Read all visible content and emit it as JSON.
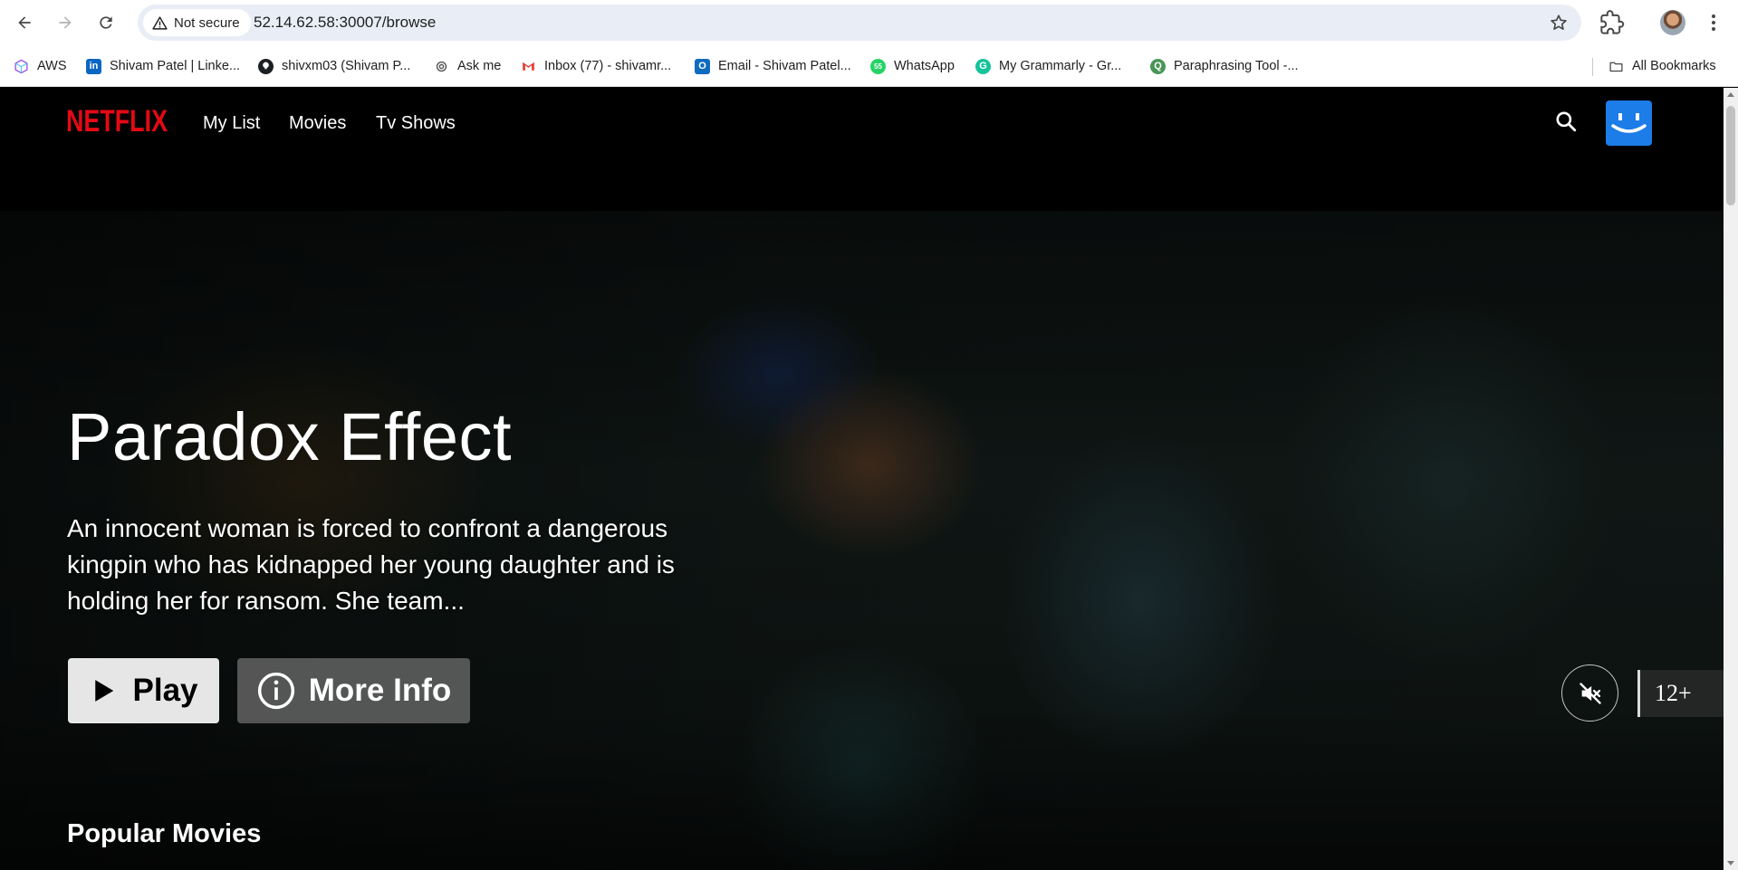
{
  "browser": {
    "security_label": "Not secure",
    "url": "52.14.62.58:30007/browse",
    "bookmarks": [
      {
        "label": "AWS",
        "icon": "aws-cube-icon"
      },
      {
        "label": "Shivam Patel | Linke...",
        "icon": "linkedin-icon"
      },
      {
        "label": "shivxm03 (Shivam P...",
        "icon": "github-icon"
      },
      {
        "label": "Ask me",
        "icon": "openai-icon"
      },
      {
        "label": "Inbox (77) - shivamr...",
        "icon": "gmail-icon"
      },
      {
        "label": "Email - Shivam Patel...",
        "icon": "outlook-icon"
      },
      {
        "label": "WhatsApp",
        "icon": "whatsapp-icon"
      },
      {
        "label": "My Grammarly - Gr...",
        "icon": "grammarly-icon"
      },
      {
        "label": "Paraphrasing Tool -...",
        "icon": "quillbot-icon"
      }
    ],
    "all_bookmarks_label": "All Bookmarks"
  },
  "netflix": {
    "logo_text": "NETFLIX",
    "nav": [
      "My List",
      "Movies",
      "Tv Shows"
    ],
    "brand_color": "#E50914",
    "profile_color": "#1C7CE8"
  },
  "hero": {
    "title": "Paradox Effect",
    "description": "An innocent woman is forced to confront a dangerous kingpin who has kidnapped her young daughter and is holding her for ransom. She team...",
    "play_label": "Play",
    "more_info_label": "More Info",
    "rating": "12+"
  },
  "rows": {
    "first_title": "Popular Movies"
  }
}
